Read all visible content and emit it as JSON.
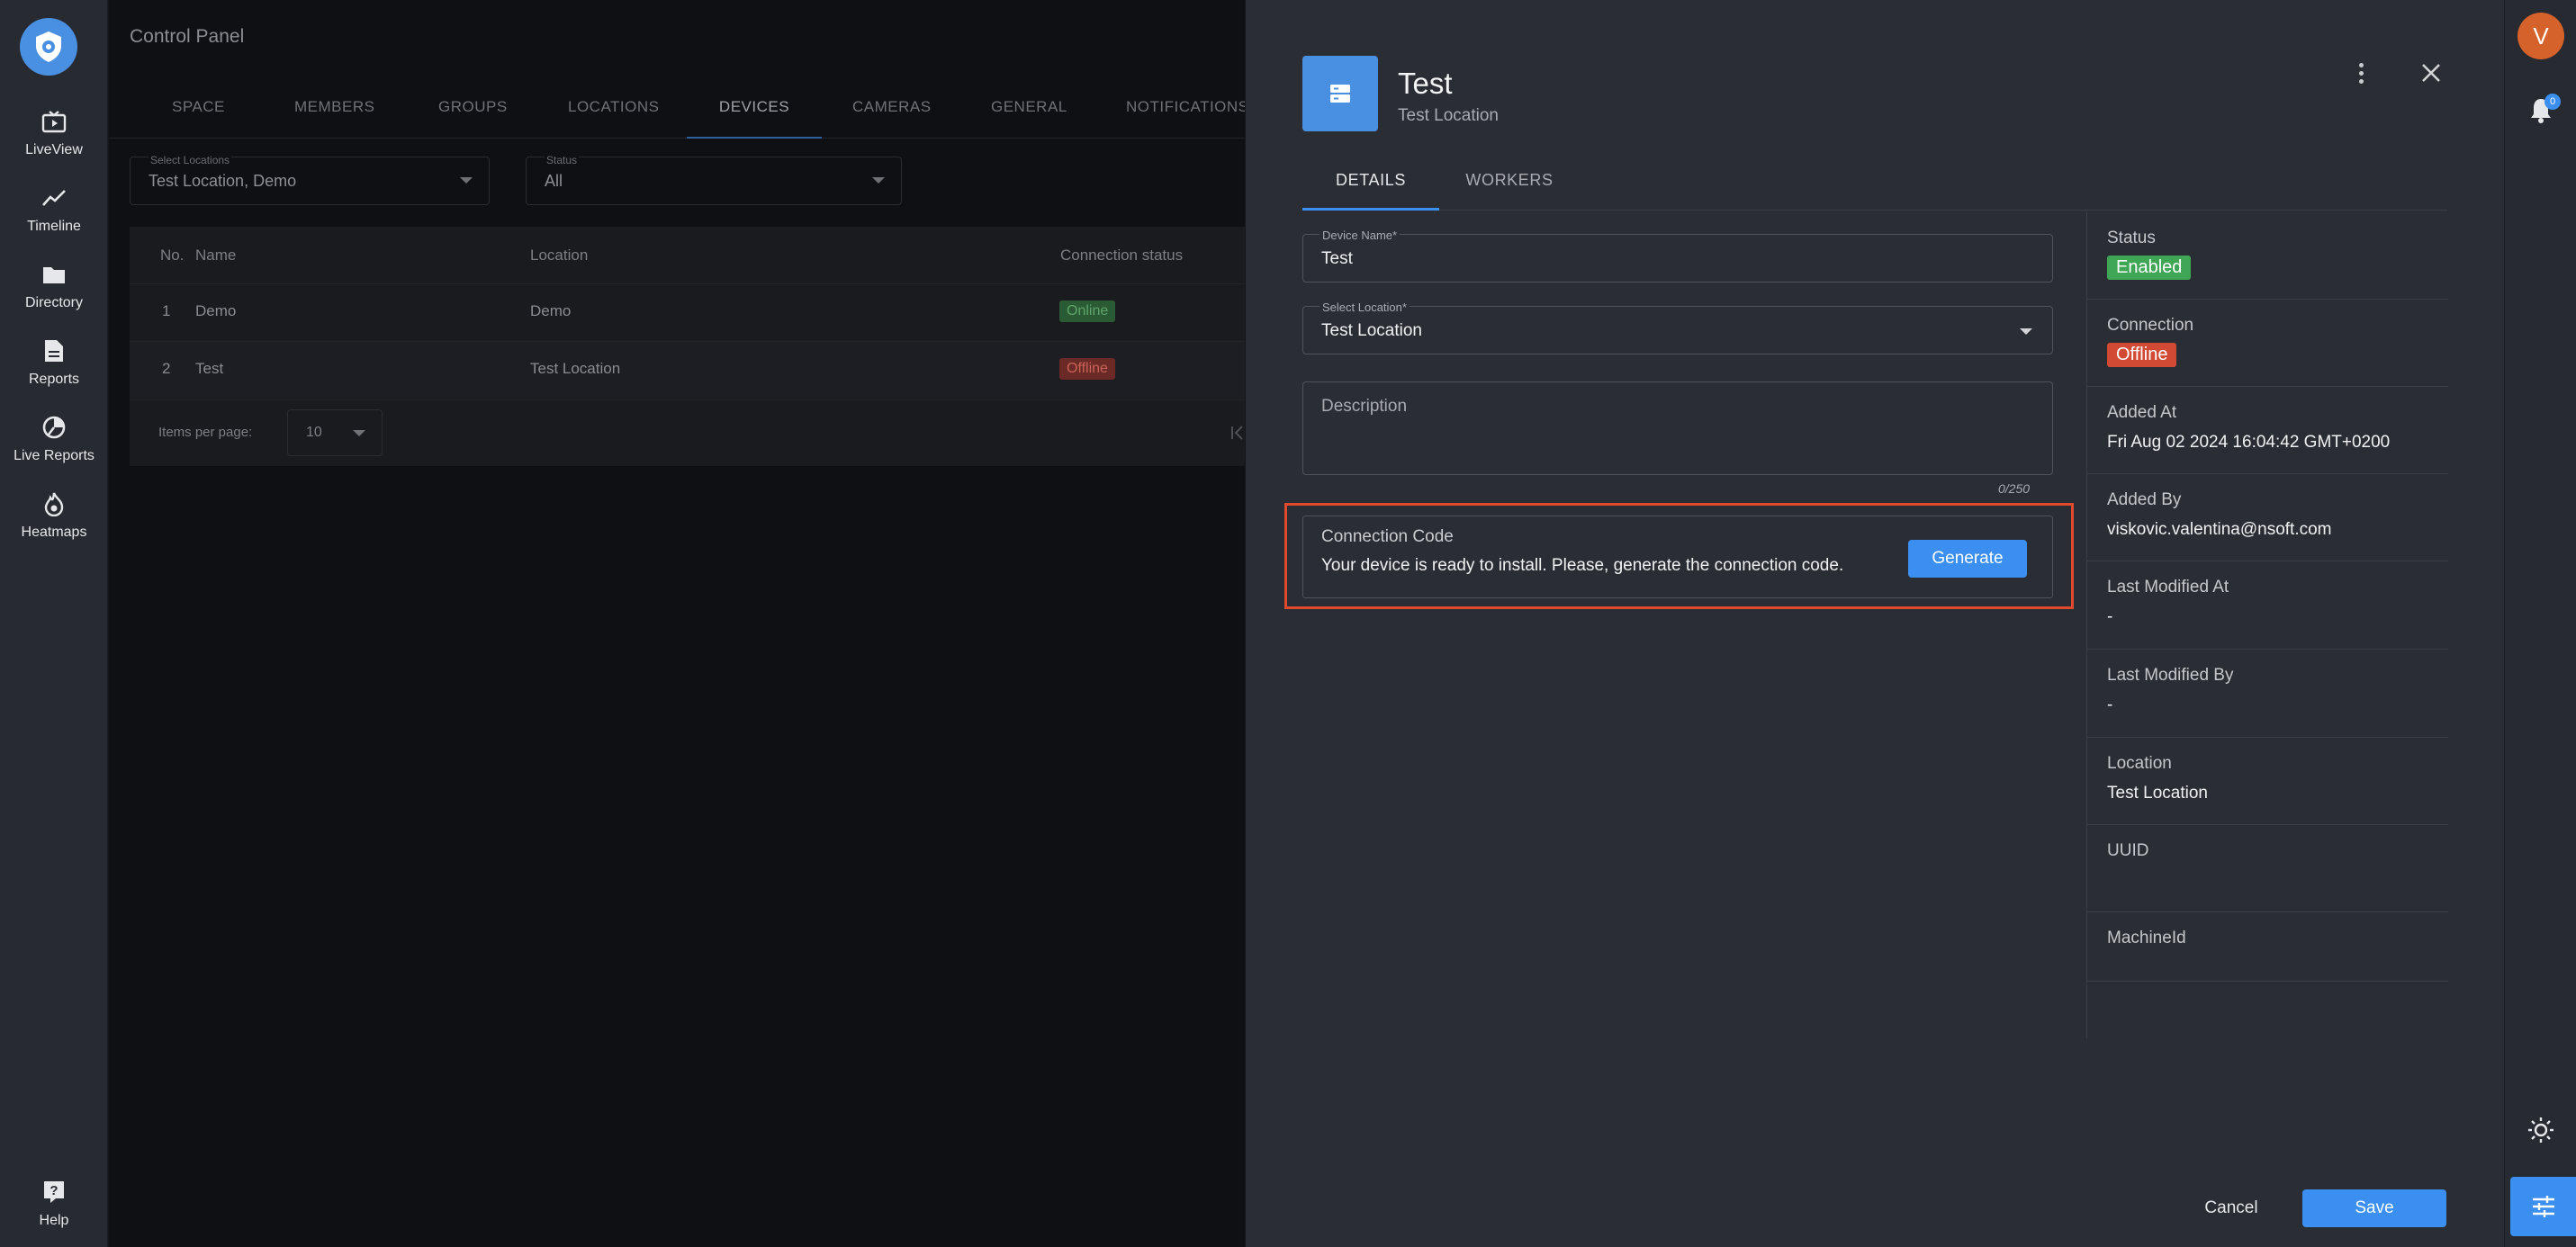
{
  "leftnav": {
    "items": [
      {
        "label": "LiveView",
        "icon": "live-view-icon"
      },
      {
        "label": "Timeline",
        "icon": "timeline-icon"
      },
      {
        "label": "Directory",
        "icon": "folder-icon"
      },
      {
        "label": "Reports",
        "icon": "report-icon"
      },
      {
        "label": "Live Reports",
        "icon": "live-report-icon"
      },
      {
        "label": "Heatmaps",
        "icon": "heatmap-icon"
      }
    ],
    "help": {
      "label": "Help",
      "icon": "help-icon"
    }
  },
  "background": {
    "title": "Control Panel",
    "tabs": [
      "SPACE",
      "MEMBERS",
      "GROUPS",
      "LOCATIONS",
      "DEVICES",
      "CAMERAS",
      "GENERAL",
      "NOTIFICATIONS"
    ],
    "active_tab": "DEVICES",
    "filters": {
      "locations": {
        "caption": "Select Locations",
        "value": "Test Location, Demo"
      },
      "status": {
        "caption": "Status",
        "value": "All"
      }
    },
    "table": {
      "columns": [
        "No.",
        "Name",
        "Location",
        "Connection status"
      ],
      "rows": [
        {
          "no": "1",
          "name": "Demo",
          "location": "Demo",
          "status": "Online"
        },
        {
          "no": "2",
          "name": "Test",
          "location": "Test Location",
          "status": "Offline"
        }
      ],
      "items_per_page_label": "Items per page:",
      "items_per_page": "10"
    }
  },
  "drawer": {
    "title": "Test",
    "subtitle": "Test Location",
    "tabs": [
      "DETAILS",
      "WORKERS"
    ],
    "form": {
      "device_name_label": "Device Name*",
      "device_name": "Test",
      "location_label": "Select Location*",
      "location": "Test Location",
      "description_placeholder": "Description",
      "description_counter": "0/250"
    },
    "connection": {
      "title": "Connection Code",
      "message": "Your device is ready to install. Please, generate the connection code.",
      "button": "Generate"
    },
    "properties": {
      "status_label": "Status",
      "status": "Enabled",
      "connection_label": "Connection",
      "connection": "Offline",
      "added_at_label": "Added At",
      "added_at": "Fri Aug 02 2024 16:04:42 GMT+0200",
      "added_by_label": "Added By",
      "added_by": "viskovic.valentina@nsoft.com",
      "last_modified_at_label": "Last Modified At",
      "last_modified_at": "-",
      "last_modified_by_label": "Last Modified By",
      "last_modified_by": "-",
      "location_label": "Location",
      "location": "Test Location",
      "uuid_label": "UUID",
      "uuid": "",
      "machine_id_label": "MachineId",
      "machine_id": ""
    },
    "footer": {
      "cancel": "Cancel",
      "save": "Save"
    }
  },
  "rightbar": {
    "avatar_initial": "V",
    "notification_count": "0"
  },
  "colors": {
    "accent": "#3b8ff0",
    "enabled": "#3fa655",
    "offline": "#d34a34",
    "highlight": "#e04a2c"
  }
}
